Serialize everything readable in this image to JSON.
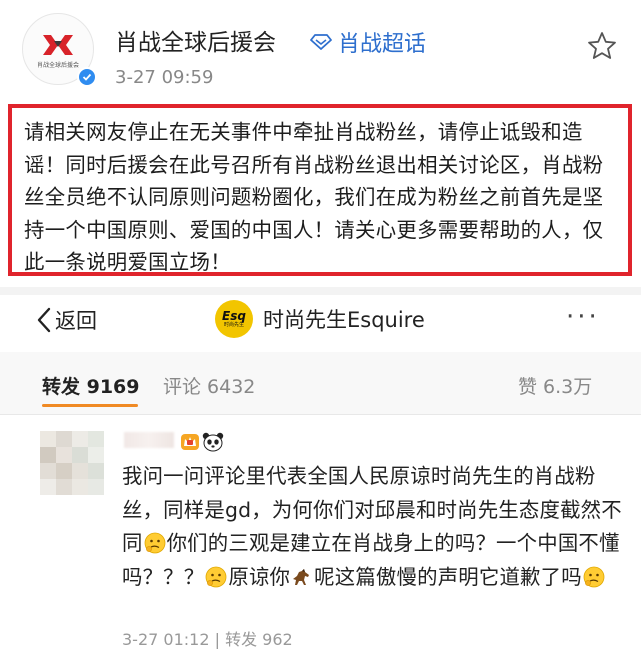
{
  "post": {
    "author": "肖战全球后援会",
    "chaohua_label": "肖战超话",
    "time": "3-27 09:59",
    "avatar_logo_text": "肖战全球后援会",
    "body": "请相关网友停止在无关事件中牵扯肖战粉丝，请停止诋毁和造谣！同时后援会在此号召所有肖战粉丝退出相关讨论区，肖战粉丝全员绝不认同原则问题粉圈化，我们在成为粉丝之前首先是坚持一个中国原则、爱国的中国人！请关心更多需要帮助的人，仅此一条说明爱国立场！",
    "highlight_color": "#e0242c"
  },
  "nav": {
    "back_label": "返回",
    "title": "时尚先生Esquire",
    "logo_text": "Esq",
    "logo_subtext": "时尚先生",
    "more_label": "···"
  },
  "tabs": {
    "repost": "转发 9169",
    "comment": "评论 6432",
    "like": "赞 6.3万",
    "active_color": "#f08a24"
  },
  "repost": {
    "text_1": "我问一问评论里代表全国人民原谅时尚先生的肖战粉丝，同样是gd，为何你们对邱晨和时尚先生态度截然不同",
    "text_2": "你们的三观是建立在肖战身上的吗？一个中国不懂吗？？？",
    "text_3": "原谅你",
    "text_4": "呢这篇傲慢的声明它道歉了吗",
    "meta": "3-27 01:12 | 转发 962"
  },
  "icons": {
    "verified": "verified-icon",
    "chaohua": "diamond-icon",
    "star": "star-icon",
    "back": "chevron-left-icon",
    "more": "more-icon"
  }
}
